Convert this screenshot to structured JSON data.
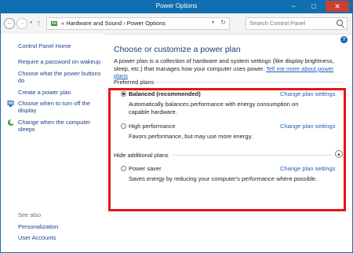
{
  "window": {
    "title": "Power Options",
    "min_glyph": "−",
    "max_glyph": "□",
    "close_glyph": "✕"
  },
  "nav": {
    "back_glyph": "←",
    "forward_glyph": "→",
    "up_glyph": "↑"
  },
  "address": {
    "path": "«  Hardware and Sound  ›  Power Options",
    "refresh_glyph": "↻"
  },
  "search": {
    "placeholder": "Search Control Panel"
  },
  "help_glyph": "?",
  "sidebar": {
    "home": "Control Panel Home",
    "items": [
      {
        "label": "Require a password on wakeup"
      },
      {
        "label": "Choose what the power buttons do"
      },
      {
        "label": "Create a power plan"
      },
      {
        "label": "Choose when to turn off the display"
      },
      {
        "label": "Change when the computer sleeps"
      }
    ],
    "see_also": "See also",
    "see_also_items": [
      {
        "label": "Personalization"
      },
      {
        "label": "User Accounts"
      }
    ]
  },
  "main": {
    "title": "Choose or customize a power plan",
    "intro": "A power plan is a collection of hardware and system settings (like display brightness, sleep, etc.) that manages how your computer uses power.",
    "intro_link": "Tell me more about power plans",
    "preferred_label": "Preferred plans",
    "hide_label": "Hide additional plans",
    "change_link": "Change plan settings",
    "plans": [
      {
        "name": "Balanced (recommended)",
        "desc": "Automatically balances performance with energy consumption on capable hardware.",
        "selected": true
      },
      {
        "name": "High performance",
        "desc": "Favors performance, but may use more energy.",
        "selected": false
      },
      {
        "name": "Power saver",
        "desc": "Saves energy by reducing your computer's performance where possible.",
        "selected": false
      }
    ]
  },
  "colors": {
    "titlebar": "#0f6fb0",
    "link": "#1f5fb5",
    "highlight": "#e8141b",
    "heading": "#1b3a78"
  }
}
